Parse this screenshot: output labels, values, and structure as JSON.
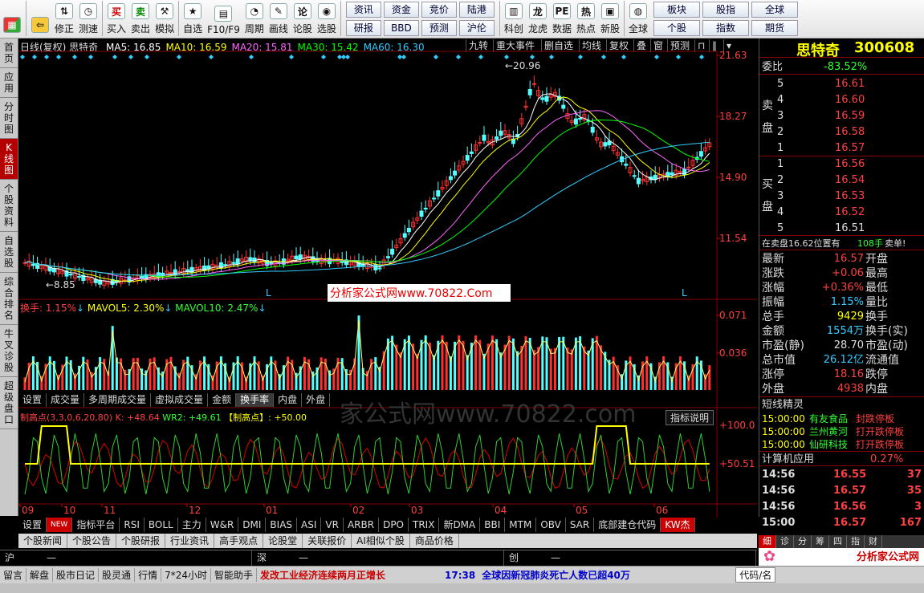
{
  "toolbar": {
    "items": [
      {
        "label": "",
        "icon": "logo-icon"
      },
      {
        "label": "",
        "icon": "back-arrow-icon"
      },
      {
        "label": "修正",
        "icon": "up-down-icon"
      },
      {
        "label": "测速",
        "icon": "clock-icon"
      },
      {
        "label": "买入",
        "icon": "buy-icon"
      },
      {
        "label": "卖出",
        "icon": "sell-icon"
      },
      {
        "label": "模拟",
        "icon": "hammer-icon"
      },
      {
        "label": "自选",
        "icon": "star-icon"
      },
      {
        "label": "F10/F9",
        "icon": "f10-icon"
      },
      {
        "label": "周期",
        "icon": "period-icon"
      },
      {
        "label": "画线",
        "icon": "pencil-icon"
      },
      {
        "label": "论股",
        "icon": "chat-icon"
      },
      {
        "label": "选股",
        "icon": "filter-icon"
      }
    ],
    "grid": [
      "资讯",
      "资金",
      "竞价",
      "陆港",
      "研报",
      "BBD",
      "预测",
      "沪伦"
    ],
    "items2": [
      {
        "label": "科创",
        "icon": "kc-icon"
      },
      {
        "label": "龙虎",
        "icon": "dragon-icon"
      },
      {
        "label": "数据",
        "icon": "pe-icon"
      },
      {
        "label": "热点",
        "icon": "hot-icon"
      },
      {
        "label": "新股",
        "icon": "new-icon"
      },
      {
        "label": "全球",
        "icon": "globe-icon"
      }
    ],
    "grid2": [
      "板块",
      "股指",
      "全球",
      "个股",
      "指数",
      "期货"
    ]
  },
  "left_tabs": [
    "首页",
    "应用",
    "分时图",
    "K线图",
    "个股资料",
    "自选股",
    "综合排名",
    "牛叉诊股",
    "超级盘口"
  ],
  "chart": {
    "header": "日线(复权) 思特奇",
    "ma": [
      {
        "label": "MA5: 16.85",
        "color": "#ffffff"
      },
      {
        "label": "MA10: 16.59",
        "color": "#ffff00"
      },
      {
        "label": "MA20: 15.81",
        "color": "#ff66ff"
      },
      {
        "label": "MA30: 15.42",
        "color": "#00ff00"
      },
      {
        "label": "MA60: 16.30",
        "color": "#33ccff"
      }
    ],
    "buttons": [
      "九转",
      "重大事件",
      "删自选",
      "均线",
      "复权",
      "叠",
      "窗",
      "预测"
    ],
    "price_ticks": [
      "21.63",
      "18.27",
      "14.90",
      "11.54"
    ],
    "high_label": "20.96",
    "low_label": "8.85",
    "watermark": "分析家公式网www.70822.Com",
    "vol_header": {
      "a": "换手: 1.15%",
      "b": "MAVOL5: 2.30%",
      "c": "MAVOL10: 2.47%"
    },
    "vol_ticks": [
      "0.071",
      "0.036"
    ],
    "vol_tabs": [
      "设置",
      "成交量",
      "多周期成交量",
      "虚拟成交量",
      "金额",
      "换手率",
      "内盘",
      "外盘"
    ],
    "ind_header": {
      "a": "制高点(3,3,0,6,20,80)",
      "b": "K: +48.64",
      "c": "WR2: +49.61",
      "d": "【制高点】: +50.00"
    },
    "ind_button": "指标说明",
    "ind_ticks": [
      "+100.0",
      "+50.51"
    ],
    "months": [
      "09",
      "10",
      "11",
      "12",
      "01",
      "02",
      "03",
      "04",
      "05",
      "06"
    ],
    "bg_watermark": "家公式网www.70822.com"
  },
  "subtabs": [
    "设置",
    "NEW",
    "指标平台",
    "RSI",
    "BOLL",
    "主力",
    "W&R",
    "DMI",
    "BIAS",
    "ASI",
    "VR",
    "ARBR",
    "DPO",
    "TRIX",
    "新DMA",
    "BBI",
    "MTM",
    "OBV",
    "SAR",
    "底部建仓代码",
    "KW杰"
  ],
  "newstabs": [
    "个股新闻",
    "个股公告",
    "个股研报",
    "行业资讯",
    "高手观点",
    "论股堂",
    "关联报价",
    "AI相似个股",
    "商品价格"
  ],
  "indices": [
    {
      "label": "沪",
      "value": "—"
    },
    {
      "label": "深",
      "value": "—"
    },
    {
      "label": "创",
      "value": "—"
    }
  ],
  "status": {
    "items": [
      "留言",
      "解盘",
      "股市日记",
      "股灵通",
      "行情",
      "7*24小时",
      "智能助手"
    ],
    "news1": "发改工业经济连续两月正增长",
    "time": "17:38",
    "news2": "全球因新冠肺炎死亡人数已超40万",
    "code": "代码/名"
  },
  "right": {
    "name": "思特奇",
    "code": "300608",
    "weibi_label": "委比",
    "weibi": "-83.52%",
    "sell": [
      {
        "n": "5",
        "p": "16.61"
      },
      {
        "n": "4",
        "p": "16.60"
      },
      {
        "n": "3",
        "p": "16.59"
      },
      {
        "n": "2",
        "p": "16.58"
      },
      {
        "n": "1",
        "p": "16.57"
      }
    ],
    "buy": [
      {
        "n": "1",
        "p": "16.56"
      },
      {
        "n": "2",
        "p": "16.54"
      },
      {
        "n": "3",
        "p": "16.53"
      },
      {
        "n": "4",
        "p": "16.52"
      },
      {
        "n": "5",
        "p": "16.51"
      }
    ],
    "sell_label": "卖盘",
    "buy_label": "买盘",
    "notice": "在卖盘16.62位置有",
    "notice_v": "108手",
    "notice_b": "卖单!",
    "quote": [
      {
        "l": "最新",
        "v": "16.57",
        "vc": "r",
        "r": "开盘"
      },
      {
        "l": "涨跌",
        "v": "+0.06",
        "vc": "r",
        "r": "最高"
      },
      {
        "l": "涨幅",
        "v": "+0.36%",
        "vc": "r",
        "r": "最低"
      },
      {
        "l": "振幅",
        "v": "1.15%",
        "vc": "c",
        "r": "量比"
      },
      {
        "l": "总手",
        "v": "9429",
        "vc": "y",
        "r": "换手"
      },
      {
        "l": "金额",
        "v": "1554万",
        "vc": "c",
        "r": "换手(实)"
      },
      {
        "l": "市盈(静)",
        "v": "28.70",
        "vc": "w",
        "r": "市盈(动)"
      },
      {
        "l": "总市值",
        "v": "26.12亿",
        "vc": "c",
        "r": "流通值"
      },
      {
        "l": "涨停",
        "v": "18.16",
        "vc": "r",
        "r": "跌停"
      },
      {
        "l": "外盘",
        "v": "4938",
        "vc": "r",
        "r": "内盘"
      }
    ],
    "short_title": "短线精灵",
    "short": [
      {
        "t": "15:00:00",
        "n": "有友食品",
        "e": "封跌停板"
      },
      {
        "t": "15:00:00",
        "n": "兰州黄河",
        "e": "打开跌停板"
      },
      {
        "t": "15:00:00",
        "n": "仙研科技",
        "e": "打开跌停板"
      }
    ],
    "calc_label": "计算机应用",
    "calc_v": "0.27%",
    "ticks": [
      {
        "t": "14:56",
        "p": "16.55",
        "v": "37"
      },
      {
        "t": "14:56",
        "p": "16.57",
        "v": "35"
      },
      {
        "t": "14:56",
        "p": "16.56",
        "v": "3"
      },
      {
        "t": "15:00",
        "p": "16.57",
        "v": "167"
      }
    ],
    "bottom_tabs": [
      "细",
      "诊",
      "分",
      "筹",
      "四",
      "指",
      "财"
    ],
    "logo_text": "分析家公式网",
    "logo_url": "www.70822.com"
  }
}
